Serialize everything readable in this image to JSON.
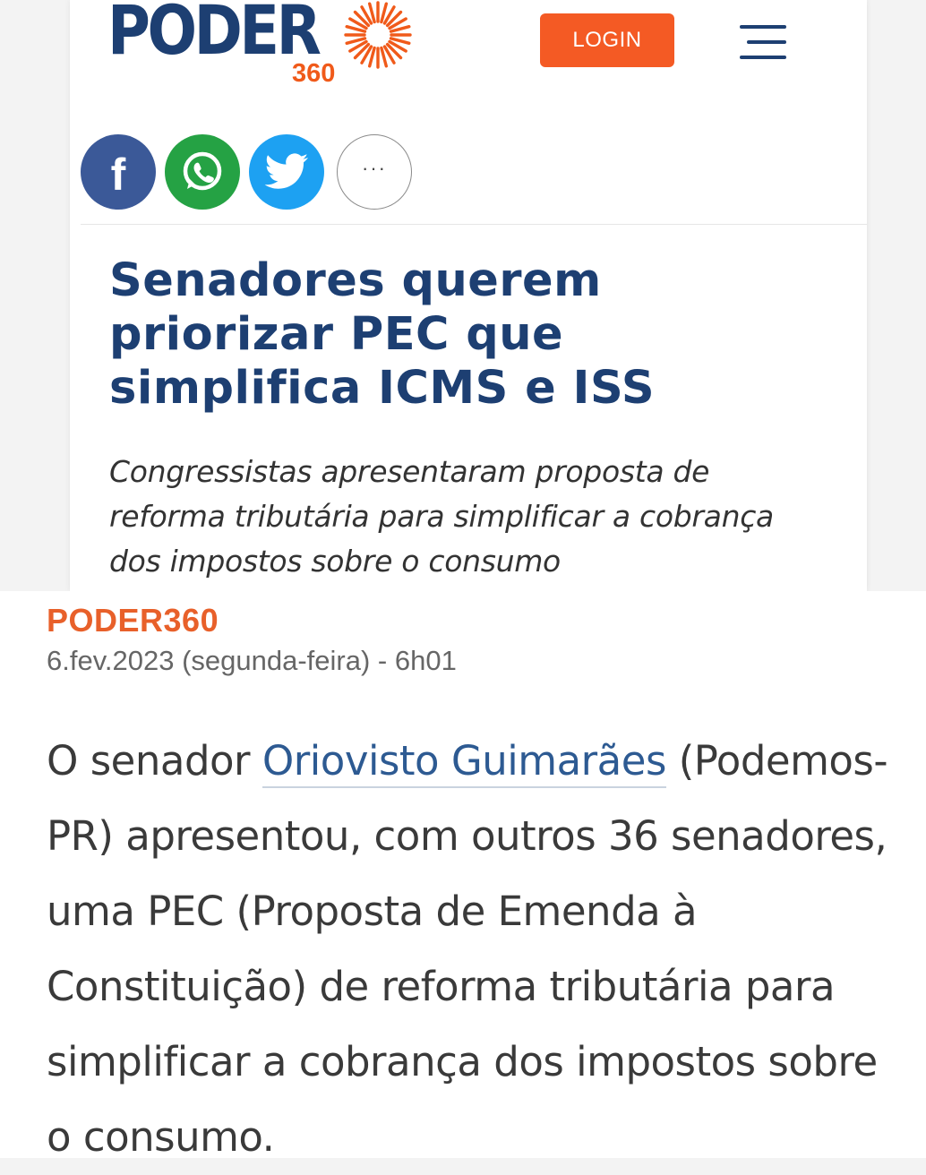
{
  "header": {
    "logo_word": "PODER",
    "logo_number": "360",
    "login_label": "LOGIN"
  },
  "share": {
    "facebook_glyph": "f",
    "more_glyph": "···",
    "icons": [
      "facebook-icon",
      "whatsapp-icon",
      "twitter-icon",
      "more-icon"
    ]
  },
  "article": {
    "headline": "Senadores querem priorizar PEC que simplifica ICMS e ISS",
    "subheadline": "Congressistas apresentaram proposta de reforma tributária para simplificar a cobrança dos impostos sobre o consumo",
    "source": "PODER360",
    "date": "6.fev.2023 (segunda-feira) - 6h01",
    "body_before_link": "O senador ",
    "body_link": "Oriovisto Guimarães",
    "body_after_link": " (Podemos-PR) apresentou, com outros 36 senadores, uma PEC (Proposta de Emenda à Constituição) de reforma tributária para simplificar a cobrança dos impostos sobre o consumo."
  },
  "colors": {
    "brand_blue": "#1d3f72",
    "brand_orange": "#f05a1a",
    "login_bg": "#f45a24",
    "facebook": "#3b5998",
    "whatsapp": "#25a244",
    "twitter": "#1da1f2",
    "link": "#2d5a92",
    "source": "#e8602a"
  }
}
